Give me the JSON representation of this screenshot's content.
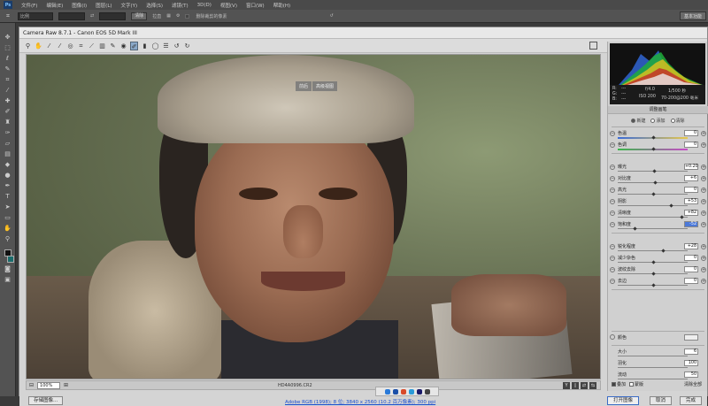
{
  "app": {
    "logo": "Ps",
    "menu": [
      "文件(F)",
      "编辑(E)",
      "图像(I)",
      "图层(L)",
      "文字(Y)",
      "选择(S)",
      "滤镜(T)",
      "3D(D)",
      "视图(V)",
      "窗口(W)",
      "帮助(H)"
    ],
    "essentials": "基本功能"
  },
  "options": {
    "preset": "比例",
    "clear": "清除",
    "straighten": "拉直",
    "delete_pixels": "删除裁剪的像素"
  },
  "camera_raw": {
    "title": "Camera Raw 8.7.1 - Canon EOS 5D Mark III",
    "preview_tabs": [
      "前后",
      "高级视图"
    ],
    "zoom": "100%",
    "file_name": "HD4A0996.CR2",
    "save_button": "存储图像...",
    "workflow_link": "Adobe RGB (1998); 8 位; 3840 x 2560 (10.2 百万像素); 300 ppi",
    "open_button": "打开图像",
    "cancel_button": "取消",
    "done_button": "完成"
  },
  "exif": {
    "r": "R:",
    "g": "G:",
    "b": "B:",
    "dash": "---",
    "aperture": "f/4.0",
    "shutter": "1/500 秒",
    "iso": "ISO 200",
    "lens": "70-200@200 毫米"
  },
  "panel": {
    "title": "调整画笔",
    "modes": [
      "新建",
      "添加",
      "清除"
    ],
    "sliders": [
      {
        "label": "色温",
        "value": "0",
        "pos": 0.5
      },
      {
        "label": "色调",
        "value": "0",
        "pos": 0.5
      },
      {
        "label": "曝光",
        "value": "+0.20",
        "pos": 0.52
      },
      {
        "label": "对比度",
        "value": "+6",
        "pos": 0.53
      },
      {
        "label": "高光",
        "value": "0",
        "pos": 0.5
      },
      {
        "label": "阴影",
        "value": "+53",
        "pos": 0.76
      },
      {
        "label": "清晰度",
        "value": "+82",
        "pos": 0.91
      },
      {
        "label": "饱和度",
        "value": "-52",
        "pos": 0.24
      },
      {
        "label": "锐化程度",
        "value": "+28",
        "pos": 0.64
      },
      {
        "label": "减少杂色",
        "value": "0",
        "pos": 0.5
      },
      {
        "label": "波纹去除",
        "value": "0",
        "pos": 0.5
      },
      {
        "label": "去边",
        "value": "0",
        "pos": 0.5
      }
    ],
    "color_label": "颜色",
    "brush": [
      {
        "label": "大小",
        "value": "6"
      },
      {
        "label": "羽化",
        "value": "100"
      },
      {
        "label": "流动",
        "value": "50"
      },
      {
        "label": "浓度",
        "value": "100"
      }
    ],
    "overlay_label": "叠加",
    "mask_label": "蒙版",
    "clear_all": "清除全部"
  },
  "colors": {
    "accent": "#4c79d8"
  }
}
